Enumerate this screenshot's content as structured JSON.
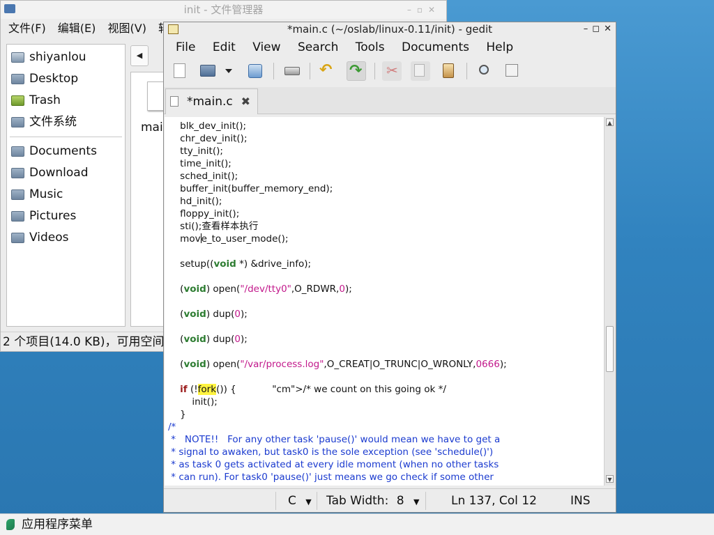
{
  "file_manager": {
    "title": "init - 文件管理器",
    "menu": [
      "文件(F)",
      "编辑(E)",
      "视图(V)",
      "转"
    ],
    "places_top": [
      {
        "label": "shiyanlou",
        "icon": "home-folder-icon"
      },
      {
        "label": "Desktop",
        "icon": "folder-icon"
      },
      {
        "label": "Trash",
        "icon": "trash-icon"
      },
      {
        "label": "文件系统",
        "icon": "drive-icon"
      }
    ],
    "places_bottom": [
      {
        "label": "Documents",
        "icon": "folder-icon"
      },
      {
        "label": "Download",
        "icon": "folder-icon"
      },
      {
        "label": "Music",
        "icon": "folder-icon"
      },
      {
        "label": "Pictures",
        "icon": "folder-icon"
      },
      {
        "label": "Videos",
        "icon": "folder-icon"
      }
    ],
    "file_label": "mai",
    "status": "2 个项目(14.0 KB)，可用空间"
  },
  "gedit": {
    "title": "*main.c (~/oslab/linux-0.11/init) - gedit",
    "menu": [
      "File",
      "Edit",
      "View",
      "Search",
      "Tools",
      "Documents",
      "Help"
    ],
    "tab_label": "*main.c",
    "code_lines": [
      "    blk_dev_init();",
      "    chr_dev_init();",
      "    tty_init();",
      "    time_init();",
      "    sched_init();",
      "    buffer_init(buffer_memory_end);",
      "    hd_init();",
      "    floppy_init();",
      "    sti();查看样本执行",
      "    move_to_user_mode();",
      "",
      "    setup((void *) &drive_info);",
      "",
      "    (void) open(\"/dev/tty0\",O_RDWR,0);",
      "",
      "    (void) dup(0);",
      "",
      "    (void) dup(0);",
      "",
      "    (void) open(\"/var/process.log\",O_CREAT|O_TRUNC|O_WRONLY,0666);",
      "",
      "    if (!fork()) {            /* we count on this going ok */",
      "        init();",
      "    }",
      "/*",
      " *   NOTE!!   For any other task 'pause()' would mean we have to get a",
      " * signal to awaken, but task0 is the sole exception (see 'schedule()')",
      " * as task 0 gets activated at every idle moment (when no other tasks",
      " * can run). For task0 'pause()' just means we go check if some other"
    ],
    "status": {
      "language": "C",
      "tab_width_label": "Tab Width:",
      "tab_width": "8",
      "position": "Ln 137, Col 12",
      "mode": "INS"
    }
  },
  "taskbar": {
    "menu_label": "应用程序菜单"
  }
}
